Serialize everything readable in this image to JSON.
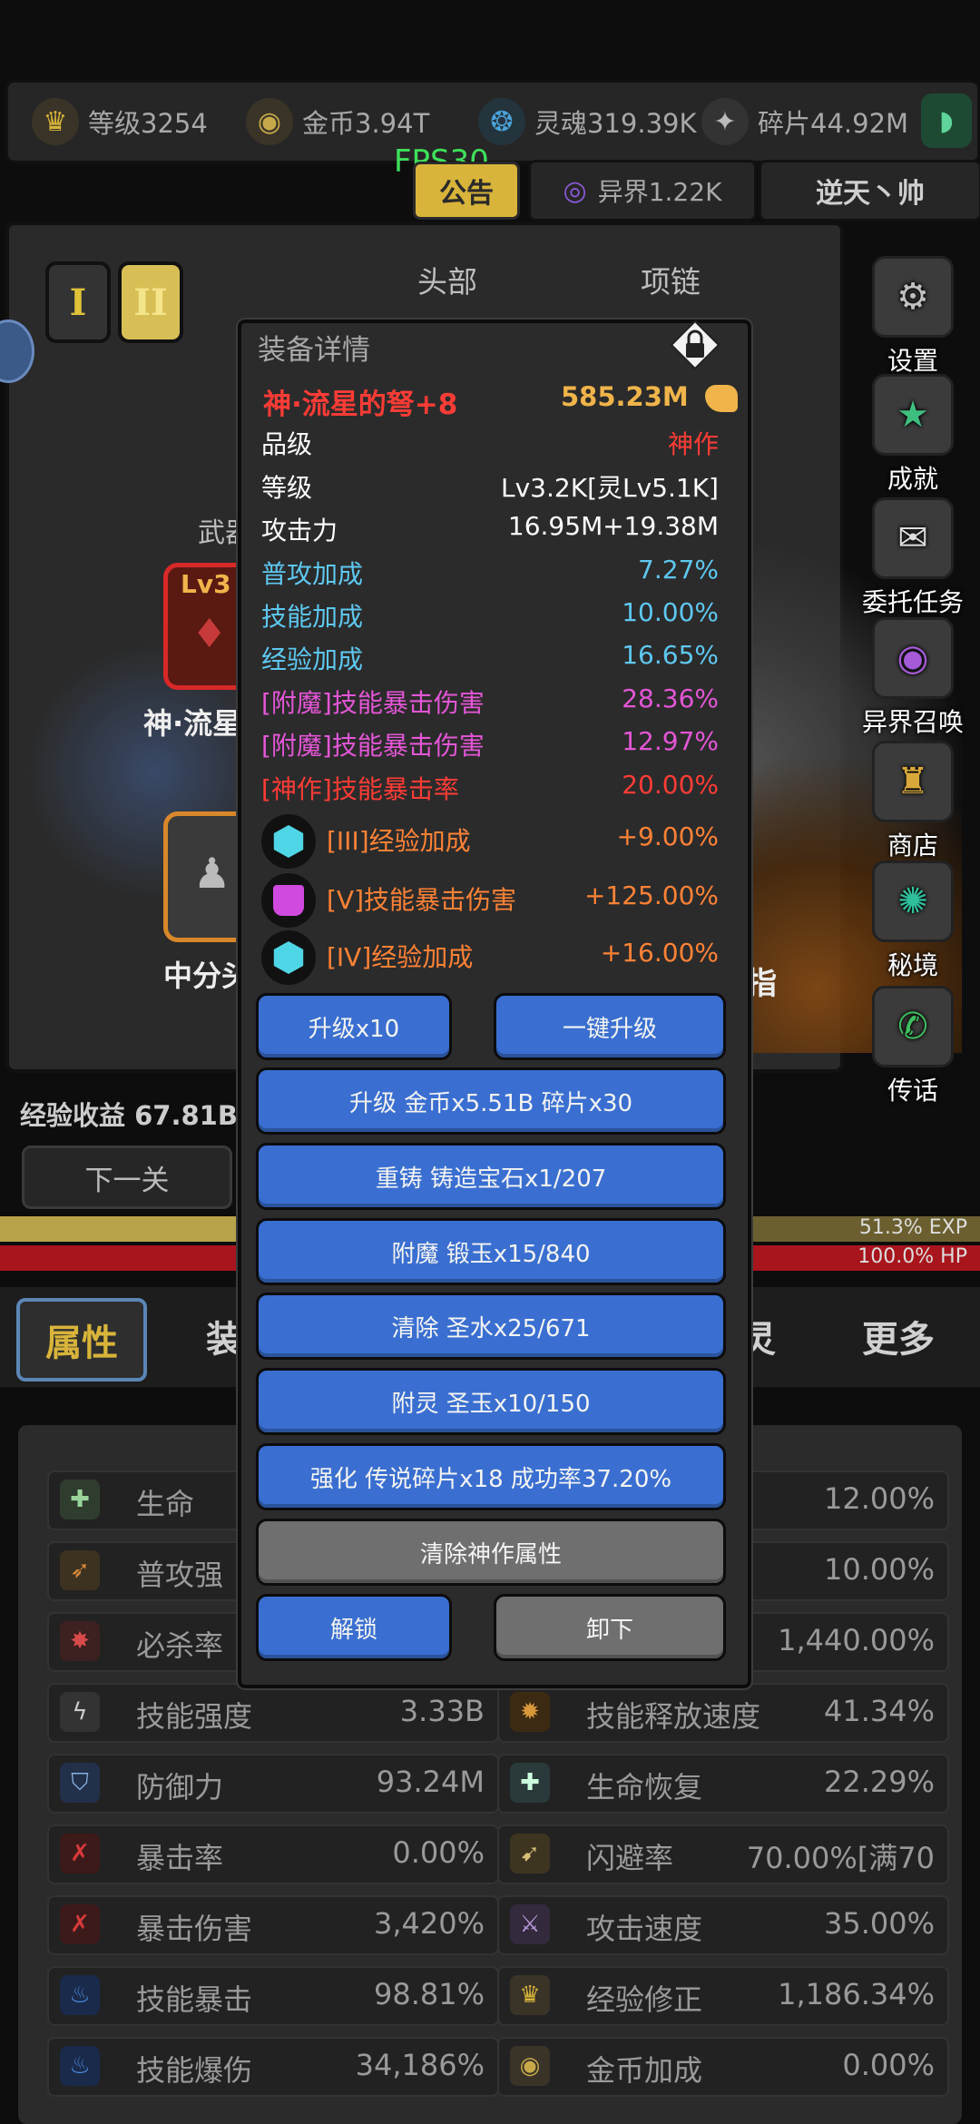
{
  "topbar": {
    "resources": [
      {
        "label": "等级3254",
        "icon": "crown-icon",
        "color": "#d8b43a"
      },
      {
        "label": "金币3.94T",
        "icon": "coin-icon",
        "color": "#c8a94a"
      },
      {
        "label": "灵魂319.39K",
        "icon": "soul-icon",
        "color": "#4aa3d8"
      },
      {
        "label": "碎片44.92M",
        "icon": "fragment-icon",
        "color": "#9a9a9a"
      }
    ],
    "fps": "FPS30",
    "notice": "公告",
    "otherworld": "异界1.22K",
    "username": "逆天丶帅"
  },
  "background": {
    "gear_tabs": [
      "I",
      "II"
    ],
    "slot_tabs": [
      "头部",
      "项链"
    ],
    "weapon_label": "武器",
    "weapon_level": "Lv3",
    "weapon_name": "神·流星",
    "armor_name": "中分头",
    "ring_label": "指",
    "exp_income": "经验收益 67.81B/",
    "next_level": "下一关",
    "exp_percent": 51.3,
    "exp_label": "51.3% EXP",
    "hp_label": "100.0% HP"
  },
  "side_menu": [
    {
      "label": "设置",
      "icon": "settings-icon"
    },
    {
      "label": "成就",
      "icon": "achievement-icon"
    },
    {
      "label": "委托任务",
      "icon": "quest-icon"
    },
    {
      "label": "异界召唤",
      "icon": "summon-icon"
    },
    {
      "label": "商店",
      "icon": "shop-icon"
    },
    {
      "label": "秘境",
      "icon": "realm-icon"
    },
    {
      "label": "传话",
      "icon": "message-icon"
    }
  ],
  "nav": {
    "tabs": [
      "属性",
      "装",
      "灵",
      "更多"
    ]
  },
  "stats": {
    "left": [
      {
        "name": "生命",
        "value": ""
      },
      {
        "name": "普攻强",
        "value": ""
      },
      {
        "name": "必杀率",
        "value": ""
      },
      {
        "name": "技能强度",
        "value": "3.33B"
      },
      {
        "name": "防御力",
        "value": "93.24M"
      },
      {
        "name": "暴击率",
        "value": "0.00%"
      },
      {
        "name": "暴击伤害",
        "value": "3,420%"
      },
      {
        "name": "技能暴击",
        "value": "98.81%"
      },
      {
        "name": "技能爆伤",
        "value": "34,186%"
      }
    ],
    "right": [
      {
        "name": "",
        "value": "12.00%"
      },
      {
        "name": "",
        "value": "10.00%"
      },
      {
        "name": "",
        "value": "1,440.00%"
      },
      {
        "name": "技能释放速度",
        "value": "41.34%"
      },
      {
        "name": "生命恢复",
        "value": "22.29%"
      },
      {
        "name": "闪避率",
        "value": "70.00%[满70"
      },
      {
        "name": "攻击速度",
        "value": "35.00%"
      },
      {
        "name": "经验修正",
        "value": "1,186.34%"
      },
      {
        "name": "金币加成",
        "value": "0.00%"
      }
    ]
  },
  "modal": {
    "title": "装备详情",
    "item_name": "神·流星的弩+8",
    "power": "585.23M",
    "attributes": [
      {
        "label": "品级",
        "value": "神作",
        "color": "#ff3c36",
        "label_color": "#ffffff"
      },
      {
        "label": "等级",
        "value": "Lv3.2K[灵Lv5.1K]",
        "color": "#ffffff",
        "label_color": "#ffffff"
      },
      {
        "label": "攻击力",
        "value": "16.95M+19.38M",
        "color": "#ffffff",
        "label_color": "#ffffff"
      },
      {
        "label": "普攻加成",
        "value": "7.27%",
        "color": "#5ec8f0",
        "label_color": "#5ec8f0"
      },
      {
        "label": "技能加成",
        "value": "10.00%",
        "color": "#5ec8f0",
        "label_color": "#5ec8f0"
      },
      {
        "label": "经验加成",
        "value": "16.65%",
        "color": "#5ec8f0",
        "label_color": "#5ec8f0"
      },
      {
        "label": "[附魔]技能暴击伤害",
        "value": "28.36%",
        "color": "#e456d6",
        "label_color": "#e456d6"
      },
      {
        "label": "[附魔]技能暴击伤害",
        "value": "12.97%",
        "color": "#e456d6",
        "label_color": "#e456d6"
      },
      {
        "label": "[神作]技能暴击率",
        "value": "20.00%",
        "color": "#ff3c36",
        "label_color": "#ff3c36"
      }
    ],
    "gems": [
      {
        "label": "[III]经验加成",
        "value": "+9.00%",
        "icon": "cyan-gem-icon",
        "color": "#4fd6e6"
      },
      {
        "label": "[V]技能暴击伤害",
        "value": "+125.00%",
        "icon": "purple-gem-icon",
        "color": "#d04ae0"
      },
      {
        "label": "[IV]经验加成",
        "value": "+16.00%",
        "icon": "cyan-gem-icon",
        "color": "#4fd6e6"
      }
    ],
    "buttons": {
      "upgrade10": "升级x10",
      "upgrade_all": "一键升级",
      "upgrade_cost": "升级 金币x5.51B 碎片x30",
      "recast": "重铸 铸造宝石x1/207",
      "enchant": "附魔 锻玉x15/840",
      "clear": "清除 圣水x25/671",
      "spirit": "附灵 圣玉x10/150",
      "strengthen": "强化 传说碎片x18 成功率37.20%",
      "clear_divine": "清除神作属性",
      "unlock": "解锁",
      "unequip": "卸下"
    }
  }
}
